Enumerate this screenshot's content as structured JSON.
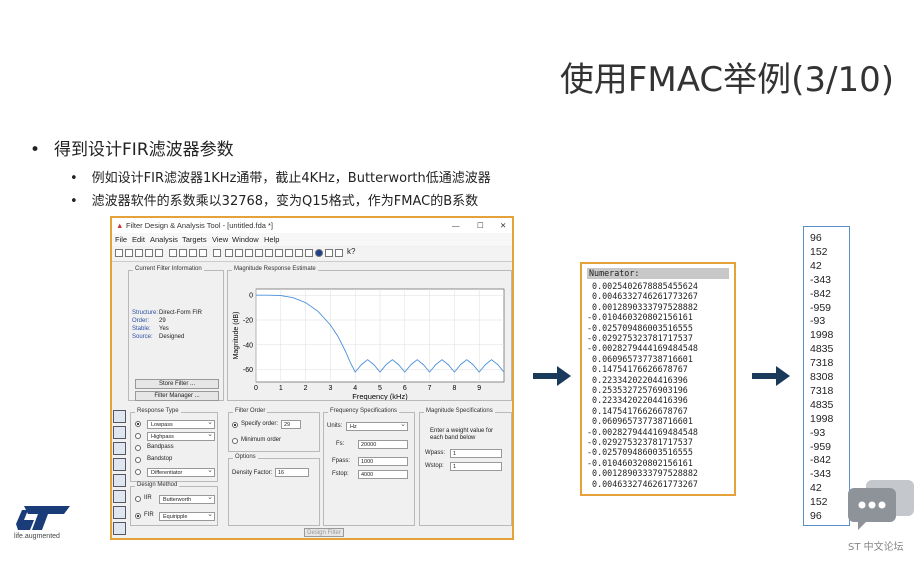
{
  "slide": {
    "title": "使用FMAC举例(3/10)",
    "bullet_main": "得到设计FIR滤波器参数",
    "sub_bullets": [
      "例如设计FIR滤波器1KHz通带，截止4KHz，Butterworth低通滤波器",
      "滤波器软件的系数乘以32768，变为Q15格式，作为FMAC的B系数"
    ],
    "logo_caption": "life.augmented",
    "forum_label": "ST 中文论坛"
  },
  "fda": {
    "window_title": "Filter Design & Analysis Tool - [untitled.fda *]",
    "menu": [
      "File",
      "Edit",
      "Analysis",
      "Targets",
      "View",
      "Window",
      "Help"
    ],
    "current_filter": {
      "label": "Current Filter Information",
      "rows": [
        {
          "k": "Structure:",
          "v": "Direct-Form FIR"
        },
        {
          "k": "Order:",
          "v": "29"
        },
        {
          "k": "Stable:",
          "v": "Yes"
        },
        {
          "k": "Source:",
          "v": "Designed"
        }
      ],
      "store_button": "Store Filter ...",
      "manager_button": "Filter Manager ..."
    },
    "plot": {
      "label": "Magnitude Response Estimate",
      "ylabel": "Magnitude (dB)",
      "xlabel": "Frequency (kHz)"
    },
    "response_type": {
      "label": "Response Type",
      "options": [
        {
          "text": "Lowpass",
          "selected": true,
          "dropdown": true
        },
        {
          "text": "Highpass",
          "selected": false,
          "dropdown": true
        },
        {
          "text": "Bandpass",
          "selected": false,
          "dropdown": false
        },
        {
          "text": "Bandstop",
          "selected": false,
          "dropdown": false
        },
        {
          "text": "Differentiator",
          "selected": false,
          "dropdown": true
        }
      ]
    },
    "design_method": {
      "label": "Design Method",
      "iir": "IIR",
      "iir_value": "Butterworth",
      "fir": "FIR",
      "fir_value": "Equiripple"
    },
    "filter_order": {
      "label": "Filter Order",
      "specify": "Specify order:",
      "specify_value": "29",
      "minimum": "Minimum order"
    },
    "options": {
      "label": "Options",
      "density_label": "Density Factor:",
      "density_value": "16"
    },
    "freq_spec": {
      "label": "Frequency Specifications",
      "units_label": "Units:",
      "units_value": "Hz",
      "fs_label": "Fs:",
      "fs_value": "20000",
      "fpass_label": "Fpass:",
      "fpass_value": "1000",
      "fstop_label": "Fstop:",
      "fstop_value": "4000"
    },
    "mag_spec": {
      "label": "Magnitude Specifications",
      "hint_line1": "Enter a weight value for",
      "hint_line2": "each band below",
      "wpass_label": "Wpass:",
      "wpass_value": "1",
      "wstop_label": "Wstop:",
      "wstop_value": "1"
    },
    "design_button": "Design Filter"
  },
  "chart_data": {
    "type": "line",
    "title": "",
    "xlabel": "Frequency (kHz)",
    "ylabel": "Magnitude (dB)",
    "xlim": [
      0,
      10
    ],
    "ylim": [
      -70,
      5
    ],
    "xticks": [
      0,
      1,
      2,
      3,
      4,
      5,
      6,
      7,
      8,
      9
    ],
    "yticks": [
      0,
      -20,
      -40,
      -60
    ],
    "grid": true,
    "series": [
      {
        "color": "#4a90d9",
        "x": [
          0,
          0.5,
          1.0,
          1.5,
          2.0,
          2.5,
          3.0,
          3.3,
          3.6,
          3.8,
          4.0,
          4.25,
          4.5,
          4.75,
          5.0,
          5.25,
          5.5,
          5.75,
          6.0,
          6.25,
          6.5,
          6.75,
          7.0,
          7.25,
          7.5,
          7.75,
          8.0,
          8.25,
          8.5,
          8.75,
          9.0,
          9.25,
          9.5,
          9.75,
          10.0
        ],
        "y": [
          0,
          0,
          -0.3,
          -2,
          -6,
          -13,
          -24,
          -33,
          -45,
          -54,
          -62,
          -56,
          -52,
          -56,
          -62,
          -56,
          -52,
          -56,
          -62,
          -56,
          -52,
          -56,
          -62,
          -56,
          -52,
          -56,
          -62,
          -56,
          -52,
          -56,
          -62,
          -56,
          -52,
          -56,
          -62
        ]
      }
    ]
  },
  "numerator": {
    "header": "Numerator:",
    "values": [
      " 0.0025402678885455624",
      " 0.0046332746261773267",
      " 0.0012890333797528882",
      "-0.010460320802156161",
      "-0.025709486003516555",
      "-0.029275323781717537",
      "-0.0028279444169484548",
      " 0.060965737738716601",
      " 0.14754176626678767",
      " 0.22334202204416396",
      " 0.25353272576903196",
      " 0.22334202204416396",
      " 0.14754176626678767",
      " 0.060965737738716601",
      "-0.0028279444169484548",
      "-0.029275323781717537",
      "-0.025709486003516555",
      "-0.010460320802156161",
      " 0.0012890333797528882",
      " 0.0046332746261773267"
    ]
  },
  "q15": {
    "values": [
      "96",
      "152",
      "42",
      "-343",
      "-842",
      "-959",
      "-93",
      "1998",
      "4835",
      "7318",
      "8308",
      "7318",
      "4835",
      "1998",
      "-93",
      "-959",
      "-842",
      "-343",
      "42",
      "152",
      "96"
    ]
  }
}
